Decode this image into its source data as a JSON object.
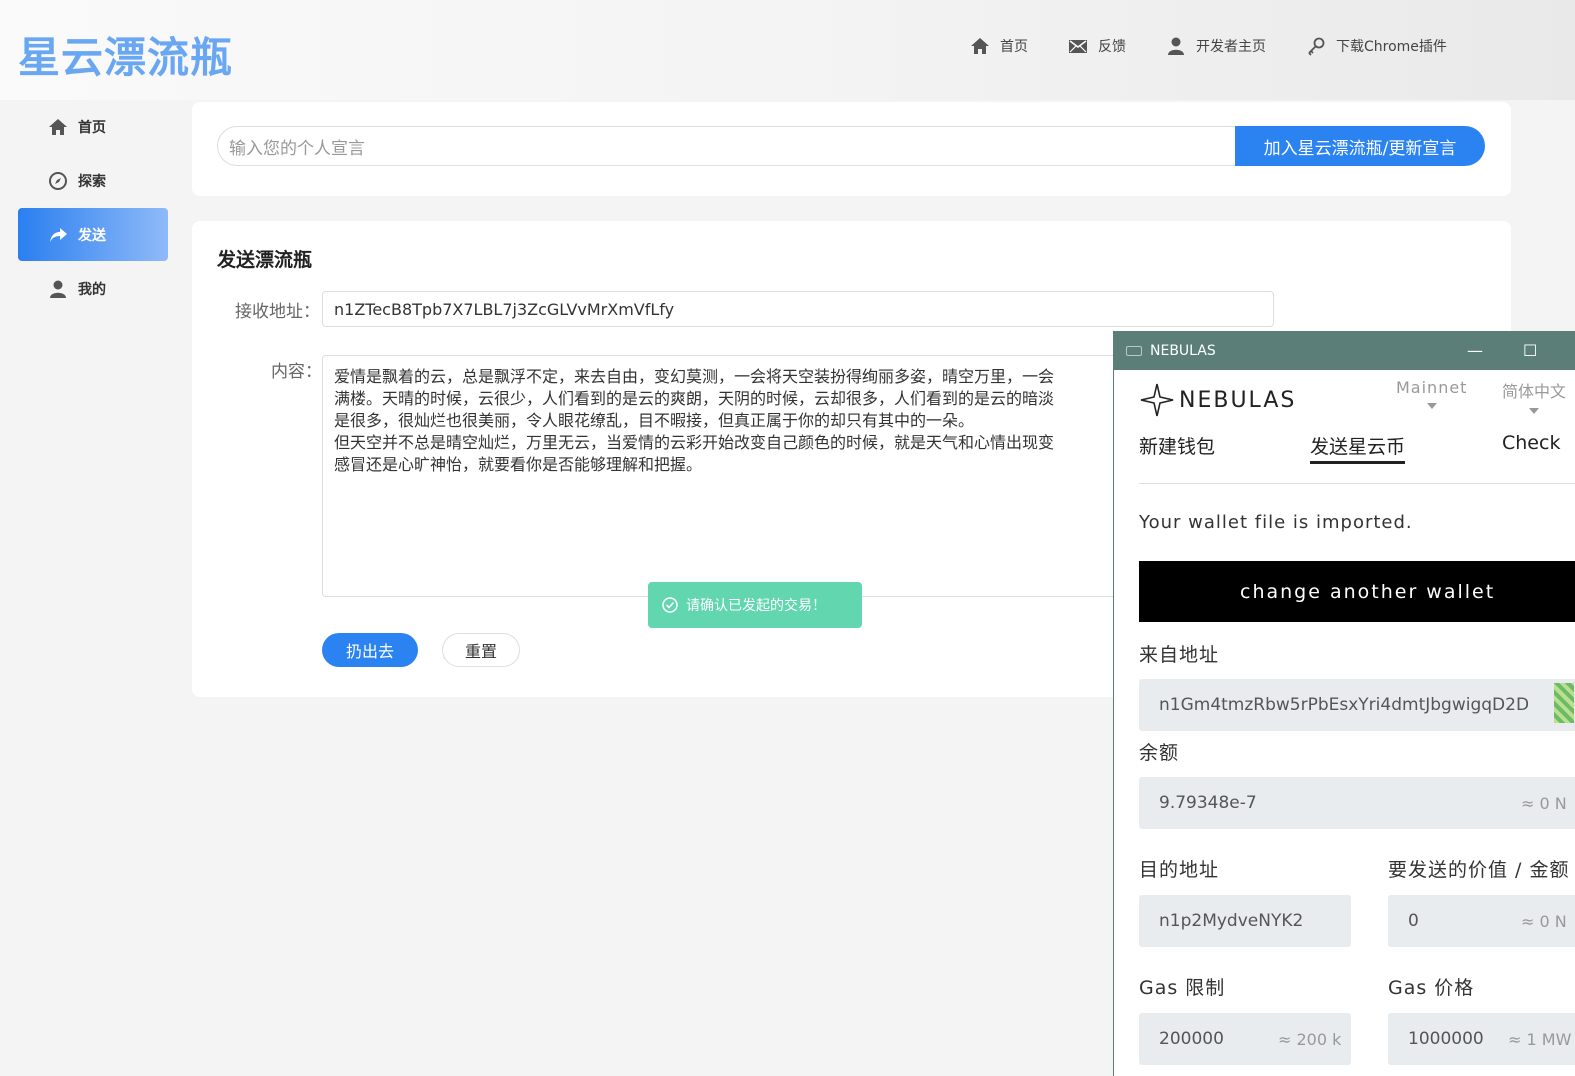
{
  "header": {
    "logo": "星云漂流瓶",
    "nav": [
      {
        "label": "首页",
        "icon": "home-icon"
      },
      {
        "label": "反馈",
        "icon": "mail-icon"
      },
      {
        "label": "开发者主页",
        "icon": "user-icon"
      },
      {
        "label": "下载Chrome插件",
        "icon": "key-icon"
      }
    ]
  },
  "sidebar": {
    "items": [
      {
        "label": "首页",
        "icon": "home-icon",
        "active": false
      },
      {
        "label": "探索",
        "icon": "compass-icon",
        "active": false
      },
      {
        "label": "发送",
        "icon": "share-icon",
        "active": true
      },
      {
        "label": "我的",
        "icon": "user-icon",
        "active": false
      }
    ]
  },
  "declaration": {
    "placeholder": "输入您的个人宣言",
    "button": "加入星云漂流瓶/更新宣言"
  },
  "send": {
    "title": "发送漂流瓶",
    "address_label": "接收地址：",
    "address_value": "n1ZTecB8Tpb7X7LBL7j3ZcGLVvMrXmVfLfy",
    "content_label": "内容：",
    "content_lines": [
      "爱情是飘着的云，总是飘浮不定，来去自由，变幻莫测，一会将天空装扮得绚丽多姿，晴空万里，一会",
      "满楼。天晴的时候，云很少，人们看到的是云的爽朗，天阴的时候，云却很多，人们看到的是云的暗淡",
      "是很多，很灿烂也很美丽，令人眼花缭乱，目不暇接，但真正属于你的却只有其中的一朵。",
      "但天空并不总是晴空灿烂，万里无云，当爱情的云彩开始改变自己颜色的时候，就是天气和心情出现变",
      "感冒还是心旷神怡，就要看你是否能够理解和把握。"
    ],
    "throw_button": "扔出去",
    "reset_button": "重置"
  },
  "toast": {
    "text": "请确认已发起的交易！",
    "color": "#62d6ae"
  },
  "nebulas": {
    "window_title": "NEBULAS",
    "minimize": "—",
    "maximize": "☐",
    "brand": "NEBULAS",
    "network": "Mainnet",
    "language": "简体中文",
    "tabs": [
      "新建钱包",
      "发送星云币",
      "Check"
    ],
    "active_tab": "发送星云币",
    "message": "Your wallet file is imported.",
    "change_button": "change another wallet",
    "from_label": "来自地址",
    "from_value": "n1Gm4tmzRbw5rPbEsxYri4dmtJbgwigqD2D",
    "balance_label": "余额",
    "balance_value": "9.79348e-7",
    "balance_hint": "≈ 0 N",
    "to_label": "目的地址",
    "to_value": "n1p2MydveNYK2",
    "value_label": "要发送的价值 / 金额",
    "value_value": "0",
    "value_hint": "≈ 0 N",
    "gas_limit_label": "Gas 限制",
    "gas_limit_value": "200000",
    "gas_limit_hint": "≈ 200 k",
    "gas_price_label": "Gas 价格",
    "gas_price_value": "1000000",
    "gas_price_hint": "≈ 1 MW"
  },
  "colors": {
    "accent": "#2b83f2",
    "logo": "#6aa7f3",
    "titlebar": "#5b7f78"
  }
}
